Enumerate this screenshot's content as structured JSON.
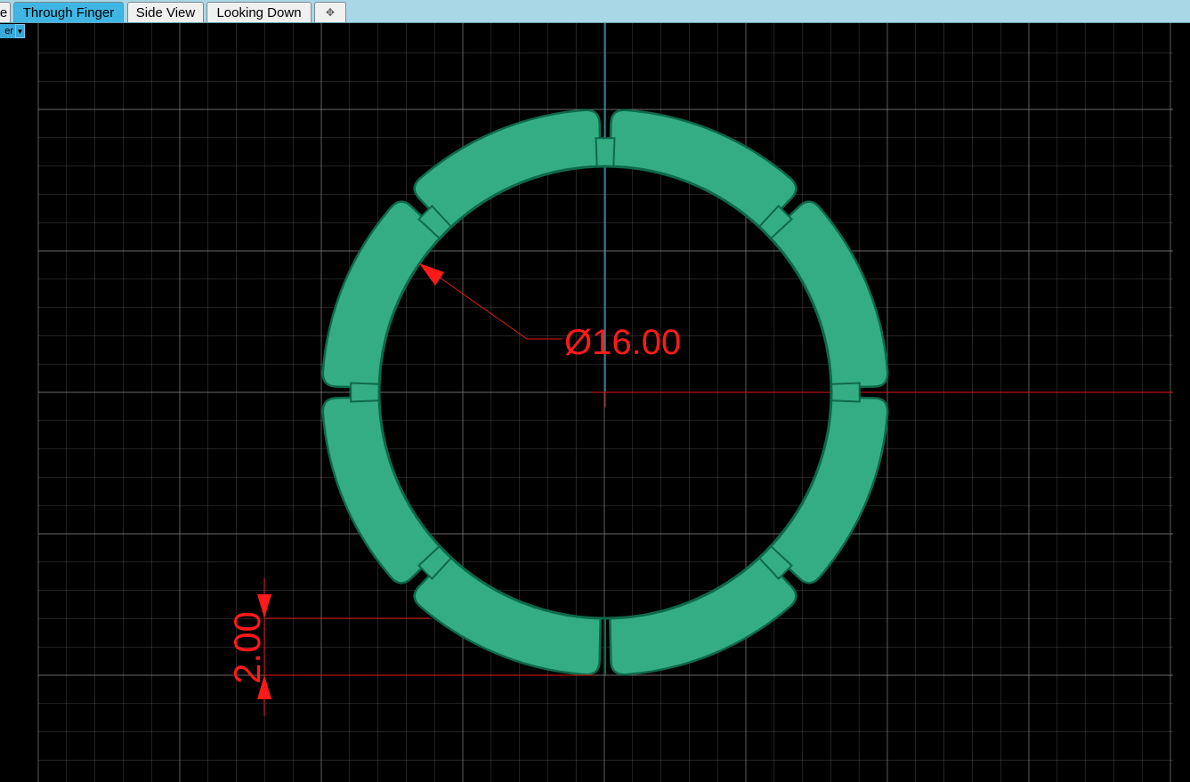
{
  "tabs": [
    {
      "label": "e"
    },
    {
      "label": "Through Finger",
      "active": true
    },
    {
      "label": "Side View"
    },
    {
      "label": "Looking Down"
    },
    {
      "label": "✥"
    }
  ],
  "view_dropdown": {
    "label": "er"
  },
  "dimensions": {
    "diameter": "Ø16.00",
    "thickness": "2.00"
  },
  "colors": {
    "ring_fill": "#35ad84",
    "ring_stroke": "#0c6a4a",
    "dimension": "#ff1a1a",
    "axis": "#1a9bc7",
    "grid": "#8a8a8a",
    "tab_active": "#3fb6e3",
    "tabbar": "#a9d7e6"
  },
  "icons": {
    "add_tab": "plus-move-icon",
    "dropdown_arrow": "chevron-down-icon"
  }
}
